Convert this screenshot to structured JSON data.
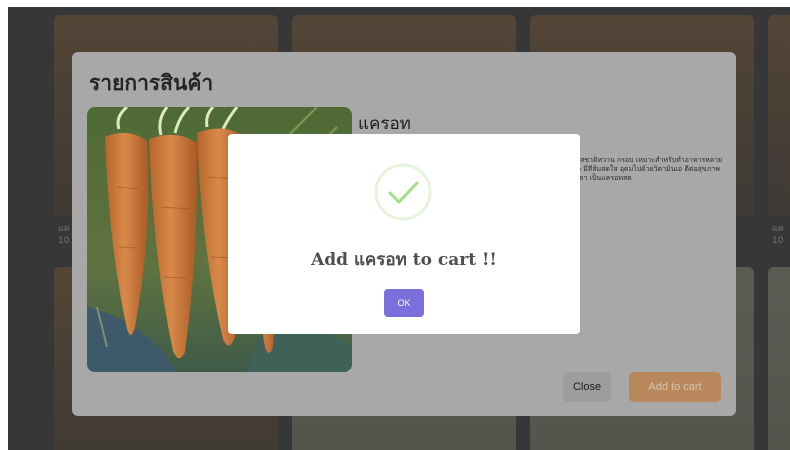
{
  "background": {
    "card_price_text": [
      "แค",
      "10",
      "แค",
      "10"
    ]
  },
  "product_modal": {
    "title": "รายการสินค้า",
    "product_name": "แครอท",
    "description": "ที่มีรสชาติหวาน กรอบ เหมาะสำหรับทำอาหารหลายชนิด มีสีส้มสดใส อุดมไปด้วยวิตามินเอ ดีต่อสุขภาพดวงตา เป็นแครอทสด",
    "close_label": "Close",
    "add_to_cart_label": "Add to cart"
  },
  "alert": {
    "icon": "success-check-icon",
    "message": "Add แครอท to cart !!",
    "ok_label": "OK",
    "ok_color": "#7b6fdc",
    "success_color": "#a5dc86"
  }
}
